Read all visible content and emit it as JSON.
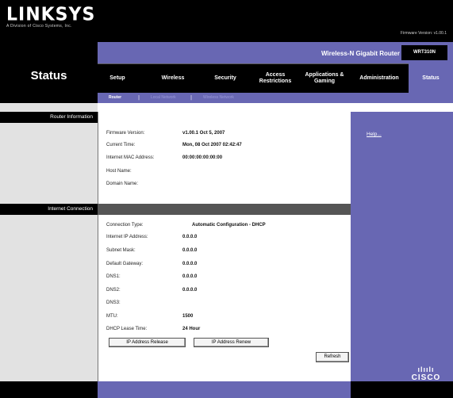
{
  "header": {
    "logo": "LINKSYS",
    "logo_sub": "A Division of Cisco Systems, Inc.",
    "firmware_label": "Firmware Version: v1.00.1",
    "product_name": "Wireless-N Gigabit Router",
    "model": "WRT310N"
  },
  "page_title": "Status",
  "tabs": [
    {
      "label": "Setup"
    },
    {
      "label": "Wireless"
    },
    {
      "label": "Security"
    },
    {
      "label": "Access Restrictions"
    },
    {
      "label": "Applications & Gaming"
    },
    {
      "label": "Administration"
    },
    {
      "label": "Status"
    }
  ],
  "subtabs": [
    {
      "label": "Router",
      "active": true
    },
    {
      "label": "Local Network",
      "active": false
    },
    {
      "label": "Wireless Network",
      "active": false
    }
  ],
  "sections": {
    "router_info": "Router Information",
    "internet_connection": "Internet Connection"
  },
  "router_info": {
    "firmware_version_label": "Firmware Version:",
    "firmware_version": "v1.00.1 Oct 5, 2007",
    "current_time_label": "Current Time:",
    "current_time": "Mon, 08 Oct 2007 02:42:47",
    "mac_label": "Internet MAC Address:",
    "mac": "00:00:00:00:00:00",
    "host_name_label": "Host Name:",
    "domain_name_label": "Domain Name:"
  },
  "internet": {
    "connection_type_label": "Connection Type:",
    "connection_type": "Automatic Configuration - DHCP",
    "ip_label": "Internet IP Address:",
    "ip": "0.0.0.0",
    "subnet_label": "Subnet Mask:",
    "subnet": "0.0.0.0",
    "gateway_label": "Default Gateway:",
    "gateway": "0.0.0.0",
    "dns1_label": "DNS1:",
    "dns1": "0.0.0.0",
    "dns2_label": "DNS2:",
    "dns2": "0.0.0.0",
    "dns3_label": "DNS3:",
    "mtu_label": "MTU:",
    "mtu": "1500",
    "lease_label": "DHCP Lease Time:",
    "lease": "24 Hour"
  },
  "buttons": {
    "ip_release": "IP Address Release",
    "ip_renew": "IP Address Renew",
    "refresh": "Refresh"
  },
  "help": {
    "link": "Help..."
  },
  "footer": {
    "cisco_mark": "ılıılı",
    "cisco_text": "CISCO"
  },
  "colors": {
    "purple": "#6867b3",
    "black": "#000000",
    "light_gray": "#e2e2e2"
  }
}
